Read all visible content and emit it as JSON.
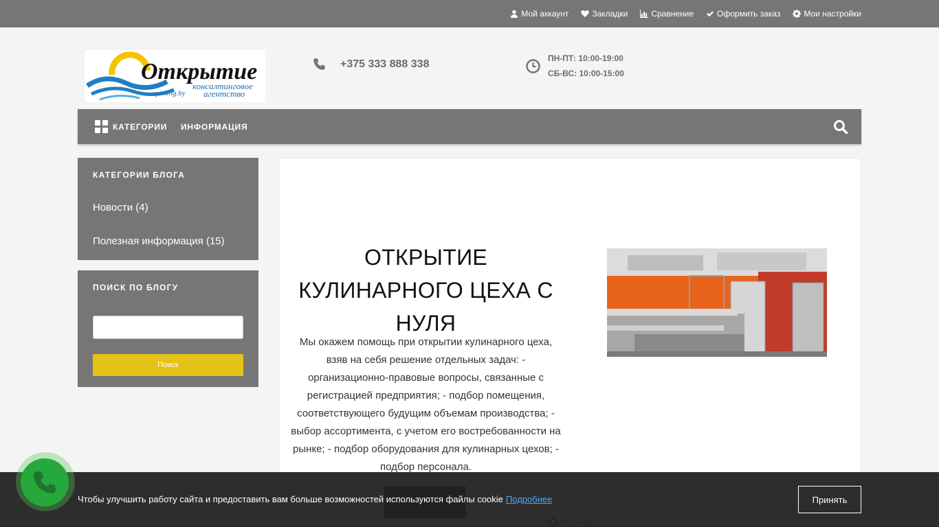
{
  "topbar": {
    "links": [
      {
        "label": "Мой аккаунт",
        "icon": "user-icon"
      },
      {
        "label": "Закладки",
        "icon": "heart-icon"
      },
      {
        "label": "Сравнение",
        "icon": "bar-chart-icon"
      },
      {
        "label": "Оформить заказ",
        "icon": "check-icon"
      },
      {
        "label": "Мои настройки",
        "icon": "gear-icon"
      }
    ]
  },
  "header": {
    "logo_text": "Открытие",
    "logo_subtitle_1": "консалтинговое",
    "logo_subtitle_2": "агентство",
    "logo_domain": "opening.by",
    "phone": "+375 333 888 338",
    "hours_weekdays": "ПН-ПТ: 10:00-19:00",
    "hours_weekend": "СБ-ВС: 10:00-15:00"
  },
  "nav": {
    "categories_label": "КАТЕГОРИИ",
    "info_label": "ИНФОРМАЦИЯ"
  },
  "sidebar": {
    "categories_title": "КАТЕГОРИИ БЛОГА",
    "categories": [
      {
        "label": "Новости (4)"
      },
      {
        "label": "Полезная информация (15)"
      }
    ],
    "search_title": "ПОИСК ПО БЛОГУ",
    "search_value": "",
    "search_button": "Поиск"
  },
  "slide": {
    "title": "ОТКРЫТИЕ КУЛИНАРНОГО ЦЕХА С НУЛЯ",
    "text": "Мы окажем помощь при открытии кулинарного цеха, взяв на себя решение отдельных задач: - организационно-правовые вопросы, связанные с регистрацией предприятия; - подбор помещения, соответствующего будущим объемам производства; - выбор ассортимента, с учетом его востребованности на рынке; - подбор оборудования для кулинарных цехов; - подбор персонала.",
    "dots": 3,
    "active_dot": 0
  },
  "cookie": {
    "text": "Чтобы улучшить работу сайта и предоставить вам больше возможностей используются файлы cookie",
    "link": "Подробнее",
    "accept": "Принять"
  },
  "colors": {
    "topbar_bg": "#767676",
    "accent_yellow": "#e5c316",
    "call_green": "#27a83b",
    "link_blue": "#47a9ff"
  }
}
